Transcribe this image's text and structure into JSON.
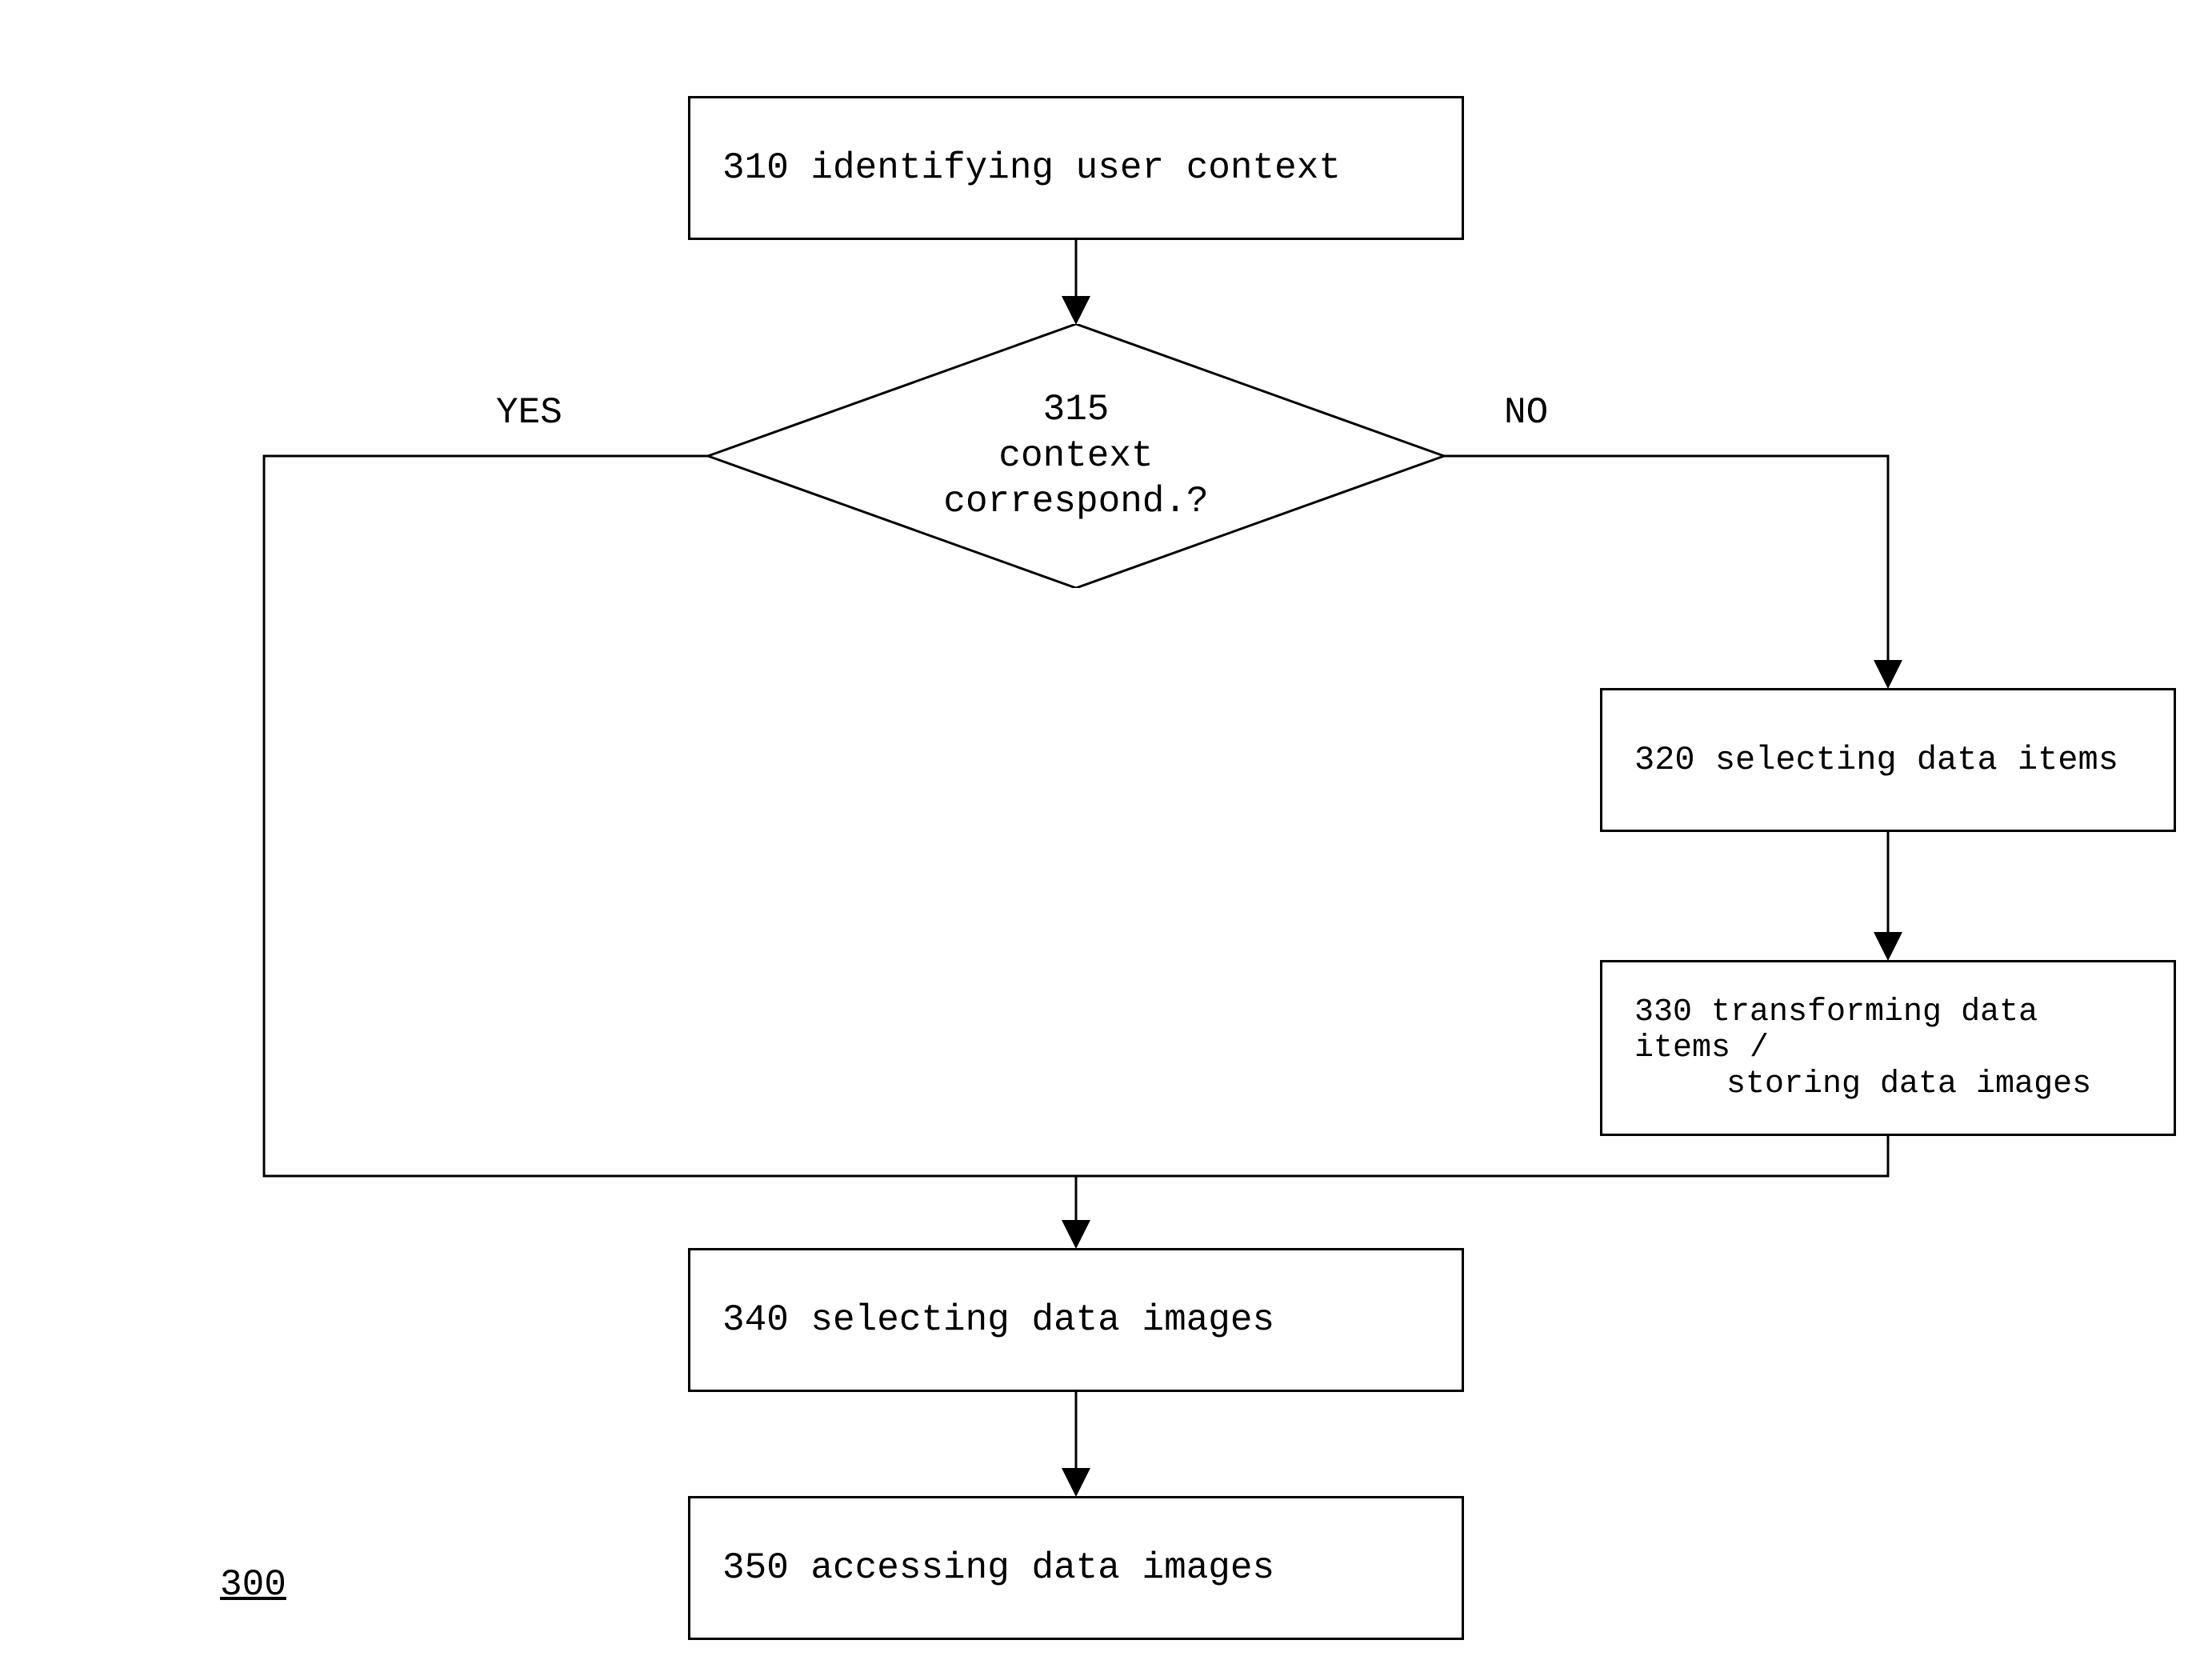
{
  "nodes": {
    "n310": "310 identifying user context",
    "n315": {
      "l1": "315",
      "l2": "context",
      "l3": "correspond.?"
    },
    "n320": "320 selecting data items",
    "n330": {
      "l1": "330 transforming data items /",
      "l2": "storing data images"
    },
    "n340": "340 selecting data images",
    "n350": "350 accessing data images"
  },
  "labels": {
    "yes": "YES",
    "no": "NO",
    "ref": "300"
  }
}
